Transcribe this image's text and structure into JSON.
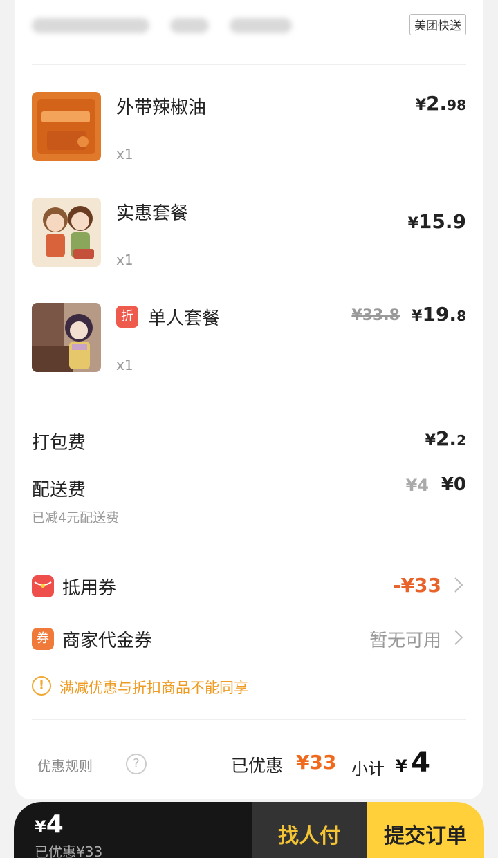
{
  "shop": {
    "delivery_tag": "美团快送"
  },
  "items": [
    {
      "name": "外带辣椒油",
      "qty": "x1",
      "price_yen": "¥",
      "price_int": "2.",
      "price_dec": "98"
    },
    {
      "name": "实惠套餐",
      "qty": "x1",
      "price_yen": "¥",
      "price_int": "15.9",
      "price_dec": ""
    },
    {
      "name": "单人套餐",
      "qty": "x1",
      "badge": "折",
      "orig_price": "¥33.8",
      "price_yen": "¥",
      "price_int": "19.",
      "price_dec": "8"
    }
  ],
  "fees": {
    "packing": {
      "label": "打包费",
      "price_yen": "¥",
      "price_int": "2.",
      "price_dec": "2"
    },
    "delivery": {
      "label": "配送费",
      "orig": "¥4",
      "price": "¥0",
      "note": "已减4元配送费"
    }
  },
  "coupons": {
    "voucher": {
      "label": "抵用券",
      "value": "-¥33",
      "color": "#e8622a"
    },
    "merchant": {
      "label": "商家代金券",
      "value": "暂无可用",
      "icon_text": "券"
    }
  },
  "warning": {
    "icon": "!",
    "text": "满减优惠与折扣商品不能同享"
  },
  "summary": {
    "rules_label": "优惠规则",
    "help_icon": "?",
    "saved_label": "已优惠",
    "saved_value": "¥33",
    "subtotal_label": "小计",
    "subtotal_yen": "¥",
    "subtotal_value": "4"
  },
  "bottom_bar": {
    "total_yen": "¥",
    "total_value": "4",
    "saved_text": "已优惠¥33",
    "pay_for_me": "找人付",
    "submit": "提交订单"
  },
  "colors": {
    "accent": "#ffd03a",
    "discount": "#f06a1e",
    "warning": "#ef9b22",
    "dark": "#161616"
  }
}
